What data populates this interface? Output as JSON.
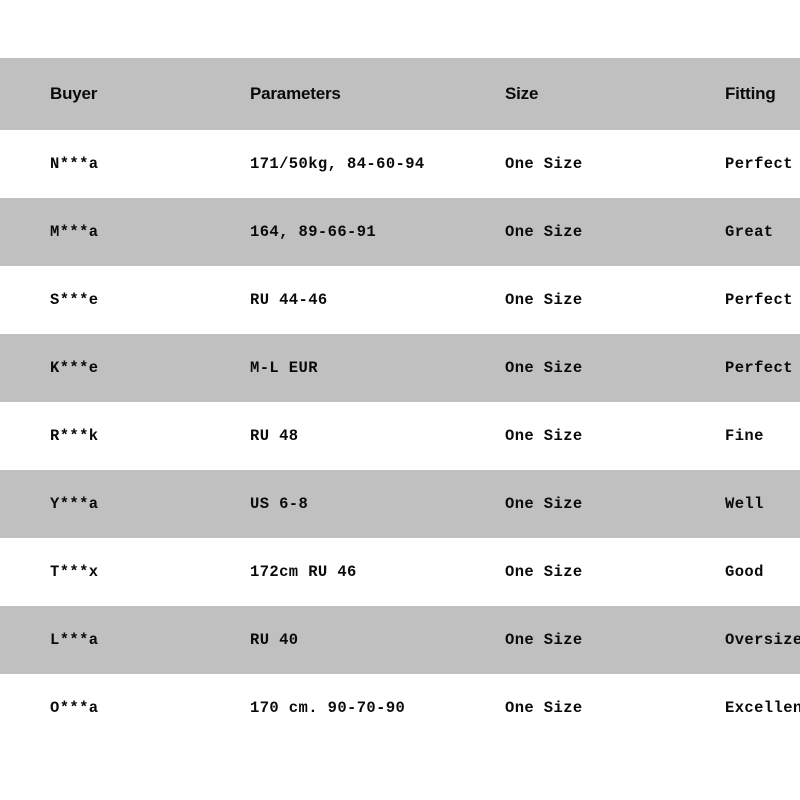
{
  "table": {
    "columns": [
      {
        "key": "buyer",
        "label": "Buyer"
      },
      {
        "key": "parameters",
        "label": "Parameters"
      },
      {
        "key": "size",
        "label": "Size"
      },
      {
        "key": "fitting",
        "label": "Fitting"
      }
    ],
    "header": {
      "buyer": "Buyer",
      "parameters": "Parameters",
      "size": "Size",
      "fitting": "Fitting"
    },
    "rows": [
      {
        "buyer": "N***a",
        "parameters": "171/50kg, 84-60-94",
        "size": "One Size",
        "fitting": "Perfect"
      },
      {
        "buyer": "M***a",
        "parameters": "164, 89-66-91",
        "size": "One Size",
        "fitting": "Great"
      },
      {
        "buyer": "S***e",
        "parameters": "RU 44-46",
        "size": "One Size",
        "fitting": "Perfect"
      },
      {
        "buyer": "K***e",
        "parameters": "M-L EUR",
        "size": "One Size",
        "fitting": "Perfect"
      },
      {
        "buyer": "R***k",
        "parameters": "RU 48",
        "size": "One Size",
        "fitting": "Fine"
      },
      {
        "buyer": "Y***a",
        "parameters": "US 6-8",
        "size": "One Size",
        "fitting": "Well"
      },
      {
        "buyer": "T***x",
        "parameters": "172cm RU 46",
        "size": "One Size",
        "fitting": "Good"
      },
      {
        "buyer": "L***a",
        "parameters": "RU 40",
        "size": "One Size",
        "fitting": "Oversize"
      },
      {
        "buyer": "O***a",
        "parameters": "170 cm. 90-70-90",
        "size": "One Size",
        "fitting": "Excellent"
      }
    ],
    "colors": {
      "band_gray": "#c0c0c0",
      "band_white": "#ffffff",
      "text": "#0a0a0a"
    }
  }
}
